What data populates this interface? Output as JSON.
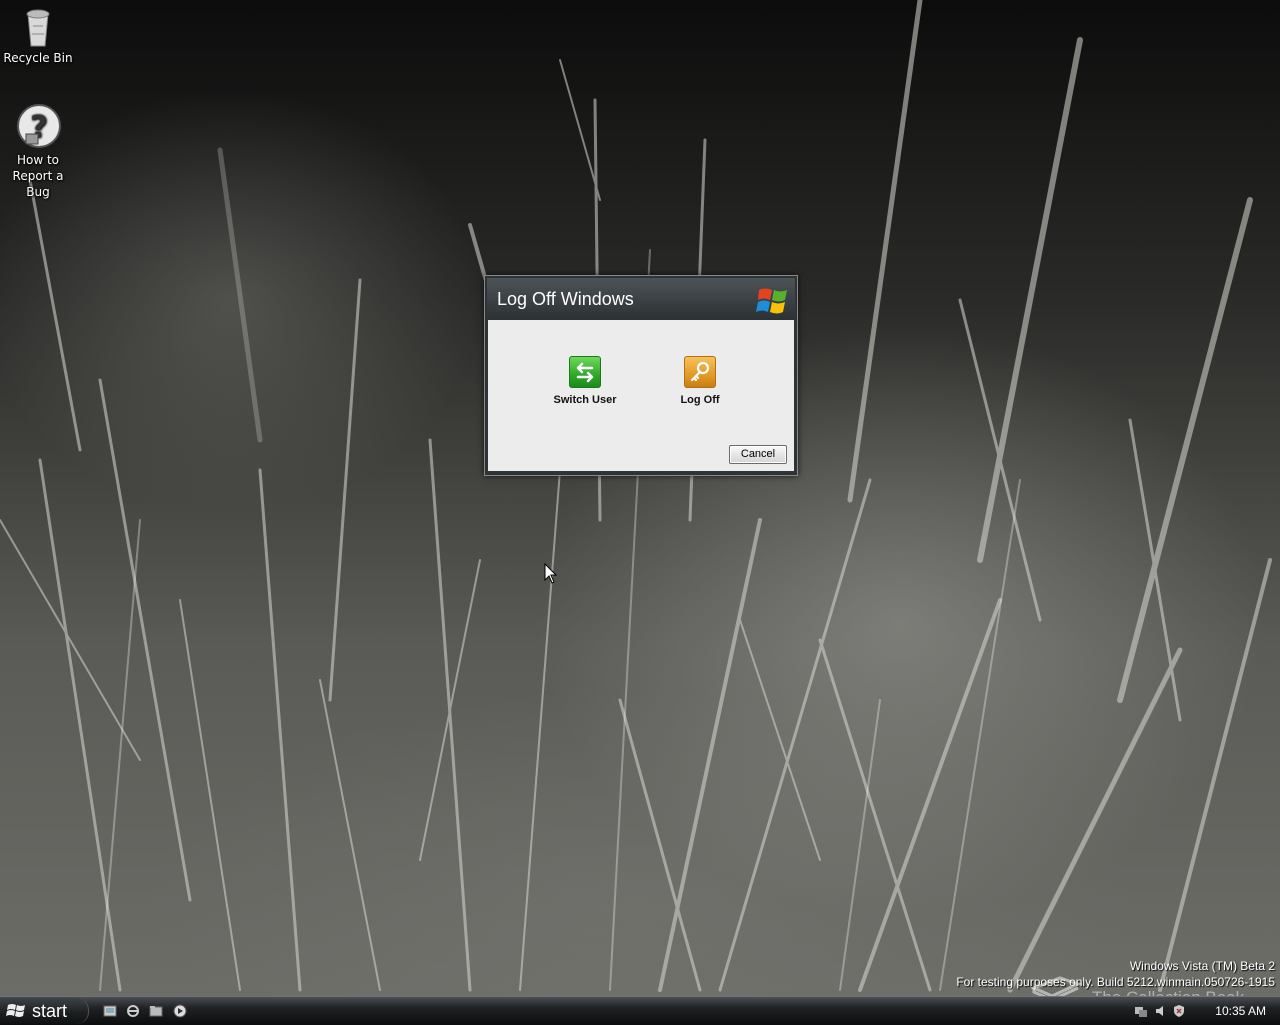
{
  "desktop": {
    "icons": [
      {
        "label": "Recycle Bin",
        "icon": "recycle-bin-icon"
      },
      {
        "label_line1": "How to",
        "label_line2": "Report a Bug",
        "icon": "help-question-icon"
      }
    ]
  },
  "dialog": {
    "title": "Log Off Windows",
    "logo": "windows-flag-logo",
    "options": [
      {
        "label": "Switch User",
        "icon": "switch-user-arrows-icon",
        "color": "#2fa82a"
      },
      {
        "label": "Log Off",
        "icon": "key-icon",
        "color": "#e39a26"
      }
    ],
    "cancel_label": "Cancel"
  },
  "watermark": {
    "line1": "Windows Vista (TM) Beta 2",
    "line2": "For testing purposes only. Build 5212.winmain.050726-1915"
  },
  "overlay_mark": "The Collection Book",
  "taskbar": {
    "start_label": "start",
    "quick_launch": [
      "show-desktop-icon",
      "internet-explorer-icon",
      "windows-explorer-icon",
      "media-player-icon"
    ],
    "clock": "10:35 AM"
  }
}
